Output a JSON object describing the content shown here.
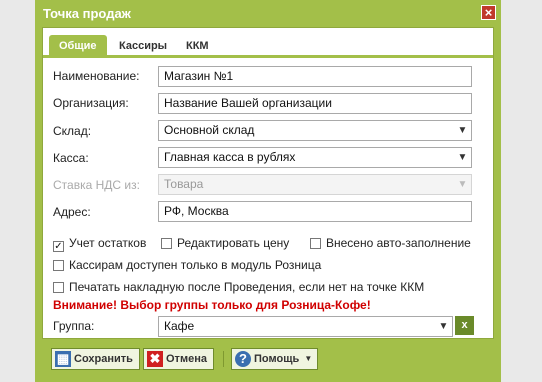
{
  "window": {
    "title": "Точка продаж",
    "close_icon": "×"
  },
  "tabs": [
    {
      "label": "Общие",
      "active": true
    },
    {
      "label": "Кассиры",
      "active": false
    },
    {
      "label": "ККМ",
      "active": false
    }
  ],
  "form": {
    "name": {
      "label": "Наименование:",
      "value": "Магазин №1"
    },
    "organization": {
      "label": "Организация:",
      "value": "Название Вашей организации"
    },
    "warehouse": {
      "label": "Склад:",
      "value": "Основной склад"
    },
    "cashbox": {
      "label": "Касса:",
      "value": "Главная касса в рублях"
    },
    "vat": {
      "label": "Ставка НДС из:",
      "value": "Товара",
      "disabled": true
    },
    "address": {
      "label": "Адрес:",
      "value": "РФ, Москва"
    },
    "checkboxes": {
      "stock_tracking": {
        "label": "Учет остатков",
        "checked": true
      },
      "edit_price": {
        "label": "Редактировать цену",
        "checked": false
      },
      "autofill": {
        "label": "Внесено авто-заполнение",
        "checked": false
      },
      "retail_only": {
        "label": "Кассирам доступен только в модуль Розница",
        "checked": false
      },
      "print_invoice": {
        "label": "Печатать накладную после Проведения, если нет на точке ККМ",
        "checked": false
      }
    },
    "warning": "Внимание! Выбор группы только для Розница-Кофе!",
    "group": {
      "label": "Группа:",
      "value": "Кафе",
      "clear_label": "x"
    }
  },
  "footer": {
    "save_label": "Сохранить",
    "cancel_label": "Отмена",
    "help_label": "Помощь"
  },
  "colors": {
    "accent": "#a3bf49",
    "warning": "#d00000",
    "close": "#c0392b"
  }
}
